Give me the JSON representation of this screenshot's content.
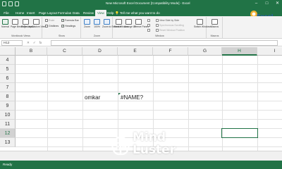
{
  "app": {
    "window_title": "New Microsoft Excel Document [Compatibility Mode] - Excel",
    "brand_logo_text": "Excel"
  },
  "ribbon": {
    "tabs": [
      "File",
      "Home",
      "Insert",
      "Page Layout",
      "Formulas",
      "Data",
      "Review",
      "View",
      "Help"
    ],
    "active_tab": "View",
    "tell_me": "Tell me what you want to do",
    "groups": {
      "workbook_views": {
        "label": "Workbook Views",
        "buttons": [
          "Normal",
          "Page Break Preview",
          "Page Layout",
          "Custom Views"
        ]
      },
      "show": {
        "label": "Show",
        "items": [
          {
            "label": "Ruler",
            "checked": false
          },
          {
            "label": "Formula Bar",
            "checked": true
          },
          {
            "label": "Gridlines",
            "checked": false
          },
          {
            "label": "Headings",
            "checked": true
          }
        ]
      },
      "zoom": {
        "label": "Zoom",
        "buttons": [
          "Zoom",
          "100%",
          "Zoom to Selection"
        ]
      },
      "window": {
        "label": "Window",
        "buttons": [
          "New Window",
          "Arrange All",
          "Freeze Panes"
        ],
        "options": [
          "View Side by Side",
          "Synchronous Scrolling",
          "Reset Window Position"
        ],
        "switch_label": "Switch Windows"
      },
      "macros": {
        "label": "Macros",
        "buttons": [
          "Macros"
        ]
      }
    }
  },
  "formula_bar": {
    "name_box": "H12",
    "fx": "fx",
    "content": ""
  },
  "grid": {
    "columns": [
      "B",
      "C",
      "D",
      "E",
      "F",
      "G",
      "H",
      "I"
    ],
    "rows": [
      "4",
      "5",
      "6",
      "7",
      "8",
      "9",
      "10",
      "11",
      "12",
      "13"
    ],
    "selected_column": "H",
    "selected_row": "12",
    "cells": [
      {
        "ref": "D8",
        "value": "omkar"
      },
      {
        "ref": "E8",
        "value": "#NAME?"
      }
    ]
  },
  "status": {
    "ready": "Ready"
  },
  "watermark": {
    "line1": "Mind",
    "line2": "Luster"
  },
  "colors": {
    "excel_green": "#217346",
    "ribbon_bg": "#f3f3f3",
    "header_bg": "#f0f0f0"
  }
}
